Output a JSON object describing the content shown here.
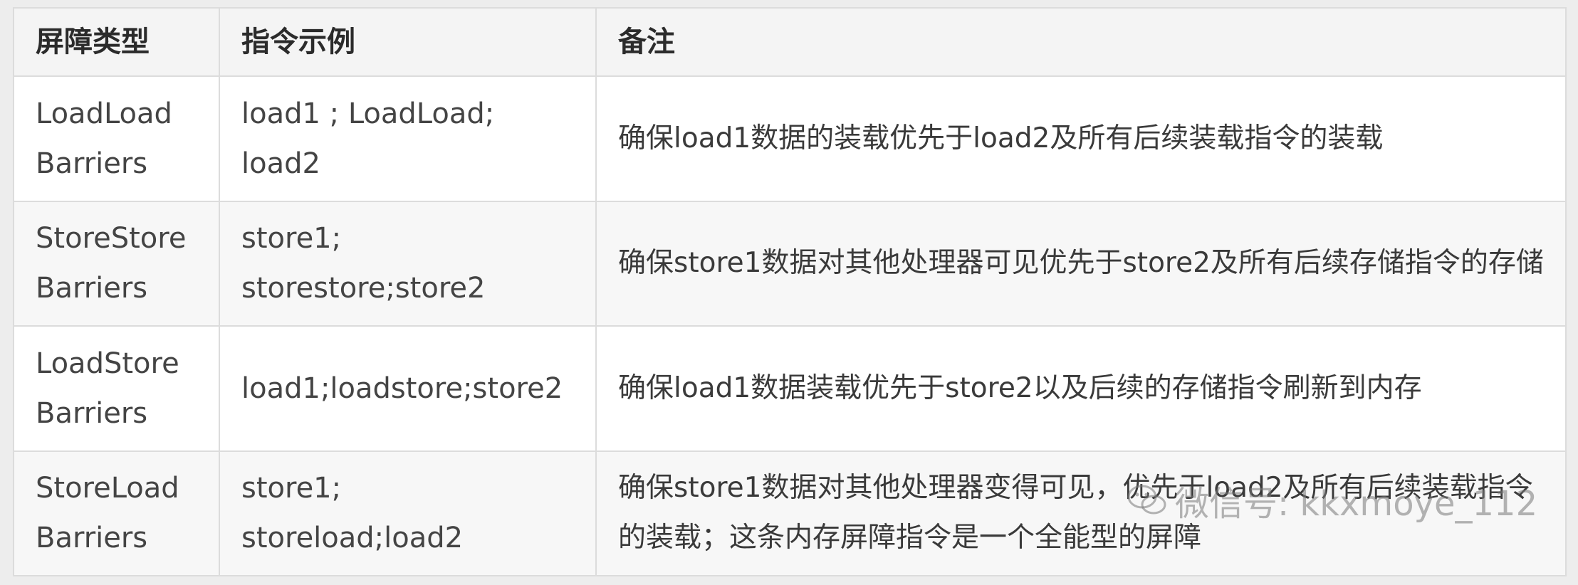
{
  "table": {
    "headers": [
      "屏障类型",
      "指令示例",
      "备注"
    ],
    "rows": [
      {
        "type_line1": "LoadLoad",
        "type_line2": "Barriers",
        "example_line1": "load1 ; LoadLoad;",
        "example_line2": "load2",
        "note": "确保load1数据的装载优先于load2及所有后续装载指令的装载"
      },
      {
        "type_line1": "StoreStore",
        "type_line2": "Barriers",
        "example_line1": "store1;",
        "example_line2": "storestore;store2",
        "note": "确保store1数据对其他处理器可见优先于store2及所有后续存储指令的存储"
      },
      {
        "type_line1": "LoadStore",
        "type_line2": "Barriers",
        "example_line1": "load1;loadstore;store2",
        "example_line2": "",
        "note": "确保load1数据装载优先于store2以及后续的存储指令刷新到内存"
      },
      {
        "type_line1": "StoreLoad",
        "type_line2": "Barriers",
        "example_line1": "store1;",
        "example_line2": "storeload;load2",
        "note": "确保store1数据对其他处理器变得可见，优先于load2及所有后续装载指令的装载；这条内存屏障指令是一个全能型的屏障"
      }
    ]
  },
  "watermark": {
    "text": "微信号: kkxmoye_112",
    "icon": "wechat-icon"
  }
}
